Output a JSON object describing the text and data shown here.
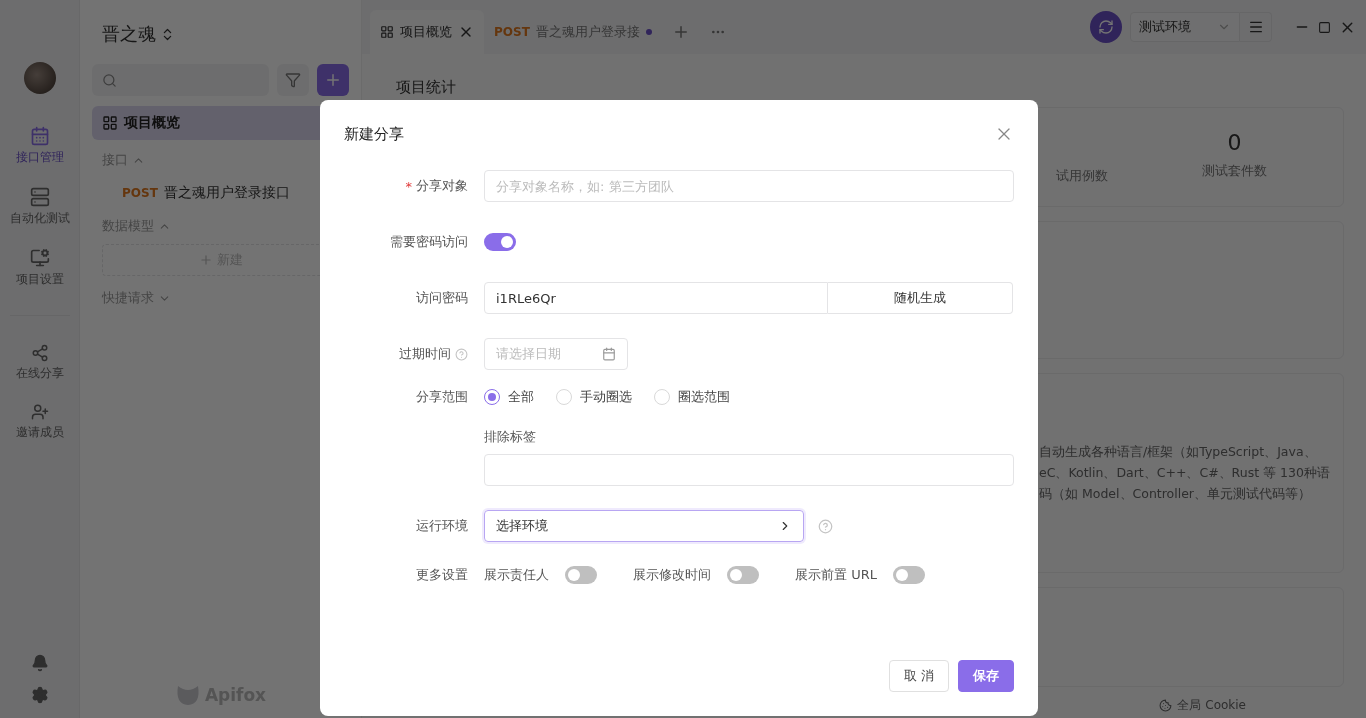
{
  "rail": {
    "items": [
      {
        "label": "接口管理",
        "selected": true
      },
      {
        "label": "自动化测试",
        "selected": false
      },
      {
        "label": "项目设置",
        "selected": false
      }
    ],
    "extra_items": [
      {
        "label": "在线分享"
      },
      {
        "label": "邀请成员"
      }
    ]
  },
  "tree": {
    "project": "晋之魂",
    "overview": {
      "label": "项目概览",
      "selected": true
    },
    "sections": [
      {
        "label": "接口",
        "expanded": true,
        "children": [
          {
            "method": "POST",
            "label": "晋之魂用户登录接口"
          }
        ]
      },
      {
        "label": "数据模型",
        "expanded": true,
        "new_button": "新建"
      },
      {
        "label": "快捷请求",
        "expanded": false
      }
    ],
    "logo": "Apifox"
  },
  "tabs": [
    {
      "label": "项目概览",
      "selected": true,
      "modified": false
    },
    {
      "method": "POST",
      "label": "晋之魂用户登录接",
      "selected": false,
      "modified": true
    }
  ],
  "environment": "测试环境",
  "content": {
    "heading": "项目统计",
    "stats": [
      {
        "label": "试用例数"
      },
      {
        "value": "0",
        "label": "测试套件数"
      }
    ],
    "intro_lines": [
      "自动生成各种语言/框架（如TypeScript、Java、",
      "eC、Kotlin、Dart、C++、C#、Rust 等 130种语",
      "码（如 Model、Controller、单元测试代码等）"
    ]
  },
  "status_bar": {
    "cookie": "全局 Cookie"
  },
  "dialog": {
    "title": "新建分享",
    "target": {
      "label": "分享对象",
      "required_mark": "*",
      "placeholder": "分享对象名称，如: 第三方团队"
    },
    "password_required": {
      "label": "需要密码访问",
      "on": true
    },
    "password": {
      "label": "访问密码",
      "value": "i1RLe6Qr",
      "button": "随机生成"
    },
    "expiry": {
      "label": "过期时间",
      "placeholder": "请选择日期"
    },
    "scope": {
      "label": "分享范围",
      "options": [
        {
          "label": "全部",
          "selected": true
        },
        {
          "label": "手动圈选",
          "selected": false
        },
        {
          "label": "圈选范围",
          "selected": false
        }
      ]
    },
    "exclude_tags": {
      "label": "排除标签"
    },
    "environment": {
      "label": "运行环境",
      "value": "选择环境"
    },
    "more": {
      "label": "更多设置",
      "toggles": [
        {
          "label": "展示责任人",
          "on": false
        },
        {
          "label": "展示修改时间",
          "on": false
        },
        {
          "label": "展示前置 URL",
          "on": false
        }
      ]
    },
    "buttons": {
      "cancel": "取 消",
      "save": "保存"
    }
  }
}
